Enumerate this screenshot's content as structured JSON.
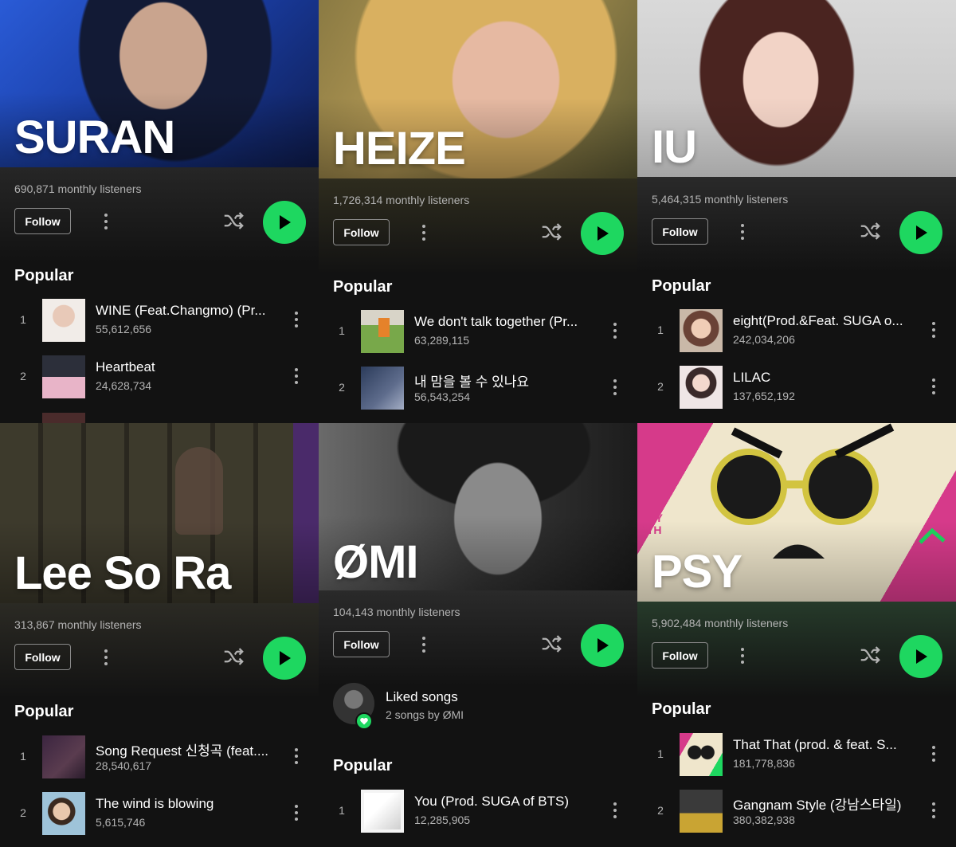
{
  "panels": [
    {
      "artist": "SURAN",
      "listeners": "690,871 monthly listeners",
      "follow_label": "Follow",
      "popular_label": "Popular",
      "tracks": [
        {
          "rank": "1",
          "title": "WINE (Feat.Changmo) (Pr...",
          "plays": "55,612,656"
        },
        {
          "rank": "2",
          "title": "Heartbeat",
          "plays": "24,628,734"
        }
      ]
    },
    {
      "artist": "HEIZE",
      "listeners": "1,726,314 monthly listeners",
      "follow_label": "Follow",
      "popular_label": "Popular",
      "tracks": [
        {
          "rank": "1",
          "title": "We don't talk together (Pr...",
          "plays": "63,289,115"
        },
        {
          "rank": "2",
          "title": "내 맘을 볼 수 있나요",
          "plays": "56,543,254"
        }
      ]
    },
    {
      "artist": "IU",
      "listeners": "5,464,315 monthly listeners",
      "follow_label": "Follow",
      "popular_label": "Popular",
      "tracks": [
        {
          "rank": "1",
          "title": "eight(Prod.&Feat. SUGA o...",
          "plays": "242,034,206"
        },
        {
          "rank": "2",
          "title": "LILAC",
          "plays": "137,652,192"
        }
      ]
    },
    {
      "artist": "Lee So Ra",
      "listeners": "313,867 monthly listeners",
      "follow_label": "Follow",
      "popular_label": "Popular",
      "tracks": [
        {
          "rank": "1",
          "title": "Song Request 신청곡 (feat....",
          "plays": "28,540,617"
        },
        {
          "rank": "2",
          "title": "The wind is blowing",
          "plays": "5,615,746"
        }
      ]
    },
    {
      "artist": "ØMI",
      "listeners": "104,143 monthly listeners",
      "follow_label": "Follow",
      "liked_title": "Liked songs",
      "liked_sub": "2 songs by ØMI",
      "popular_label": "Popular",
      "tracks": [
        {
          "rank": "1",
          "title": "You (Prod. SUGA of BTS)",
          "plays": "12,285,905"
        }
      ]
    },
    {
      "artist": "PSY",
      "listeners": "5,902,484 monthly listeners",
      "follow_label": "Follow",
      "popular_label": "Popular",
      "psy_art_text": "PSY 9TH",
      "tracks": [
        {
          "rank": "1",
          "title": "That That (prod. & feat. S...",
          "plays": "181,778,836"
        },
        {
          "rank": "2",
          "title": "Gangnam Style (강남스타일)",
          "plays": "380,382,938"
        }
      ]
    }
  ],
  "colors": {
    "accent": "#1ed760",
    "background": "#121212",
    "secondary_text": "#b3b3b3"
  },
  "icons": [
    "more-vertical-icon",
    "shuffle-icon",
    "play-icon",
    "heart-icon"
  ]
}
